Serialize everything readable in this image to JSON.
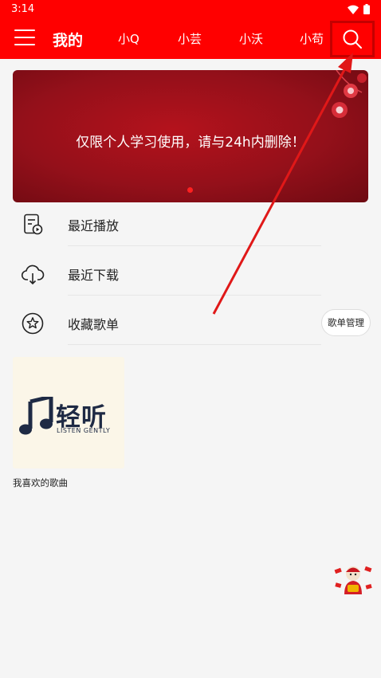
{
  "status_bar": {
    "time": "3:14"
  },
  "nav": {
    "title": "我的",
    "tabs": [
      "小Q",
      "小芸",
      "小沃",
      "小苟"
    ]
  },
  "banner": {
    "text": "仅限个人学习使用，请与24h内删除！"
  },
  "menu": {
    "items": [
      {
        "label": "最近播放",
        "icon": "recent-play-icon"
      },
      {
        "label": "最近下载",
        "icon": "cloud-download-icon"
      },
      {
        "label": "收藏歌单",
        "icon": "star-icon"
      }
    ],
    "manage_label": "歌单管理"
  },
  "playlists": [
    {
      "name": "我喜欢的歌曲",
      "cover_brand": "轻听",
      "cover_tagline": "LISTEN GENTLY"
    }
  ],
  "colors": {
    "accent": "#ff0000",
    "banner": "#94101a",
    "cover_text": "#1e2a44"
  }
}
